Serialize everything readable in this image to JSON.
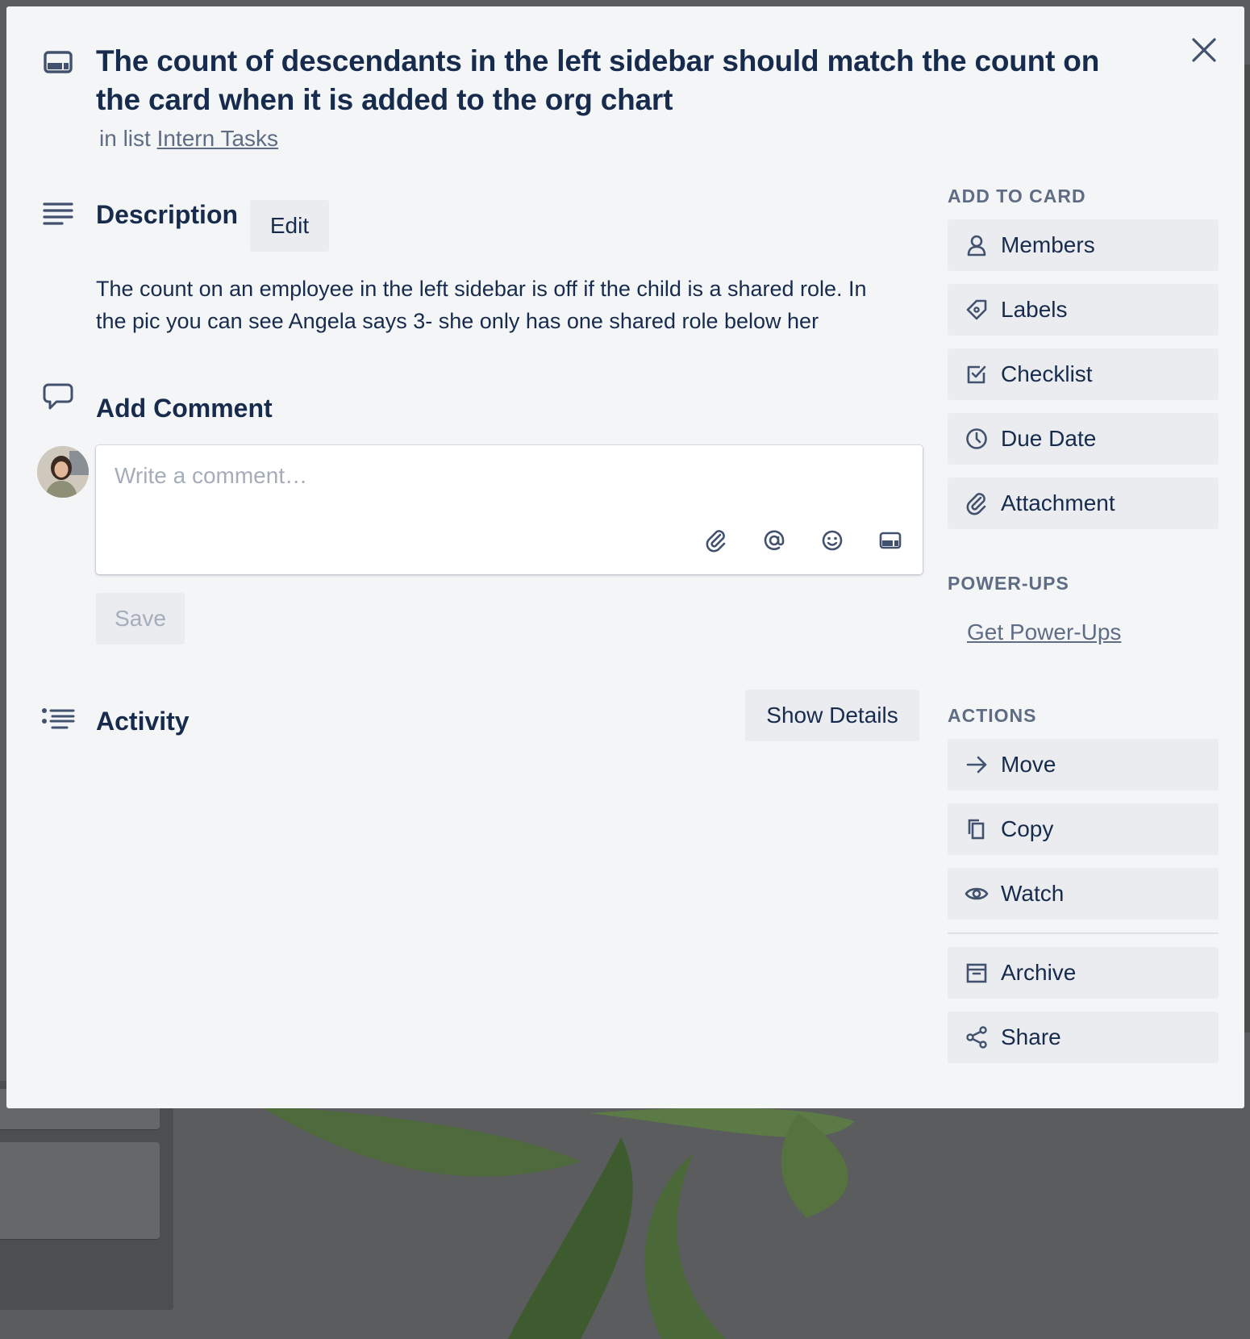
{
  "card": {
    "title": "The count of descendants in the left sidebar should match the count on the card when it is added to the org chart",
    "in_list_prefix": "in list",
    "list_name": "Intern Tasks"
  },
  "description": {
    "heading": "Description",
    "edit_label": "Edit",
    "text": "The count on an employee in the left sidebar is off if the child is a shared role. In the pic you can see Angela says 3- she only has one shared role below her"
  },
  "comment": {
    "heading": "Add Comment",
    "placeholder": "Write a comment…",
    "save_label": "Save",
    "tools": [
      "paperclip-icon",
      "mention-icon",
      "emoji-icon",
      "card-icon"
    ]
  },
  "activity": {
    "heading": "Activity",
    "show_details_label": "Show Details"
  },
  "sidebar": {
    "add_to_card_heading": "ADD TO CARD",
    "add_to_card": [
      {
        "label": "Members",
        "icon": "person-icon"
      },
      {
        "label": "Labels",
        "icon": "tag-icon"
      },
      {
        "label": "Checklist",
        "icon": "checkbox-icon"
      },
      {
        "label": "Due Date",
        "icon": "clock-icon"
      },
      {
        "label": "Attachment",
        "icon": "paperclip-icon"
      }
    ],
    "powerups_heading": "POWER-UPS",
    "powerups_link": "Get Power-Ups",
    "actions_heading": "ACTIONS",
    "actions": [
      {
        "label": "Move",
        "icon": "arrow-right-icon"
      },
      {
        "label": "Copy",
        "icon": "copy-icon"
      },
      {
        "label": "Watch",
        "icon": "eye-icon"
      },
      {
        "label": "Archive",
        "icon": "archive-icon"
      },
      {
        "label": "Share",
        "icon": "share-icon"
      }
    ]
  },
  "colors": {
    "modal_bg": "#f4f5f7",
    "button_bg": "#ebecf0",
    "text_primary": "#172b4d",
    "text_subtle": "#5e6c84",
    "backdrop": "#5b5c5d"
  }
}
